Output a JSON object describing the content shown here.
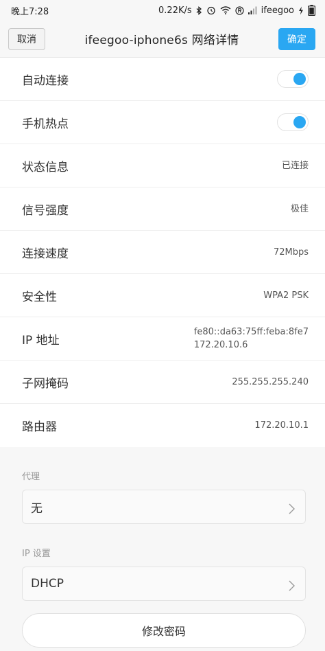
{
  "status_bar": {
    "time": "晚上7:28",
    "speed": "0.22K/s",
    "carrier": "ifeegoo"
  },
  "header": {
    "cancel_label": "取消",
    "title": "ifeegoo-iphone6s  网络详情",
    "confirm_label": "确定"
  },
  "rows": [
    {
      "label": "自动连接",
      "type": "toggle",
      "on": true
    },
    {
      "label": "手机热点",
      "type": "toggle",
      "on": true
    },
    {
      "label": "状态信息",
      "value": "已连接"
    },
    {
      "label": "信号强度",
      "value": "极佳"
    },
    {
      "label": "连接速度",
      "value": "72Mbps"
    },
    {
      "label": "安全性",
      "value": "WPA2 PSK"
    },
    {
      "label": "IP 地址",
      "value_line1": "fe80::da63:75ff:feba:8fe7",
      "value_line2": "172.20.10.6"
    },
    {
      "label": "子网掩码",
      "value": "255.255.255.240"
    },
    {
      "label": "路由器",
      "value": "172.20.10.1"
    }
  ],
  "proxy": {
    "label": "代理",
    "value": "无"
  },
  "ip_settings": {
    "label": "IP 设置",
    "value": "DHCP"
  },
  "change_password_label": "修改密码",
  "colors": {
    "accent": "#2aa7f2",
    "background": "#f7f7f7"
  }
}
